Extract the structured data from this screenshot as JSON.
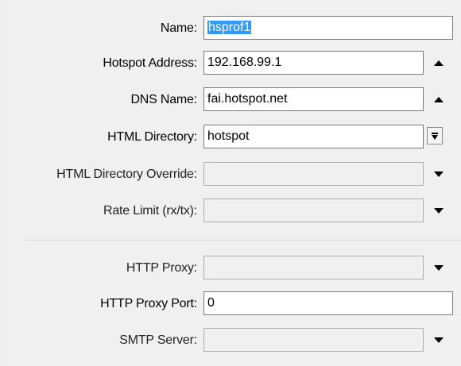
{
  "form": {
    "name": {
      "label": "Name:",
      "value": "hsprof1"
    },
    "hotspot_address": {
      "label": "Hotspot Address:",
      "value": "192.168.99.1"
    },
    "dns_name": {
      "label": "DNS Name:",
      "value": "fai.hotspot.net"
    },
    "html_directory": {
      "label": "HTML Directory:",
      "value": "hotspot"
    },
    "html_directory_override": {
      "label": "HTML Directory Override:",
      "value": ""
    },
    "rate_limit": {
      "label": "Rate Limit (rx/tx):",
      "value": ""
    },
    "http_proxy": {
      "label": "HTTP Proxy:",
      "value": ""
    },
    "http_proxy_port": {
      "label": "HTTP Proxy Port:",
      "value": "0"
    },
    "smtp_server": {
      "label": "SMTP Server:",
      "value": ""
    }
  },
  "icons": {
    "collapse": "triangle-up-icon",
    "expand": "triangle-down-icon",
    "dropdown": "dropdown-box-icon"
  },
  "colors": {
    "selection": "#3399ff",
    "background": "#f0f0f0"
  }
}
